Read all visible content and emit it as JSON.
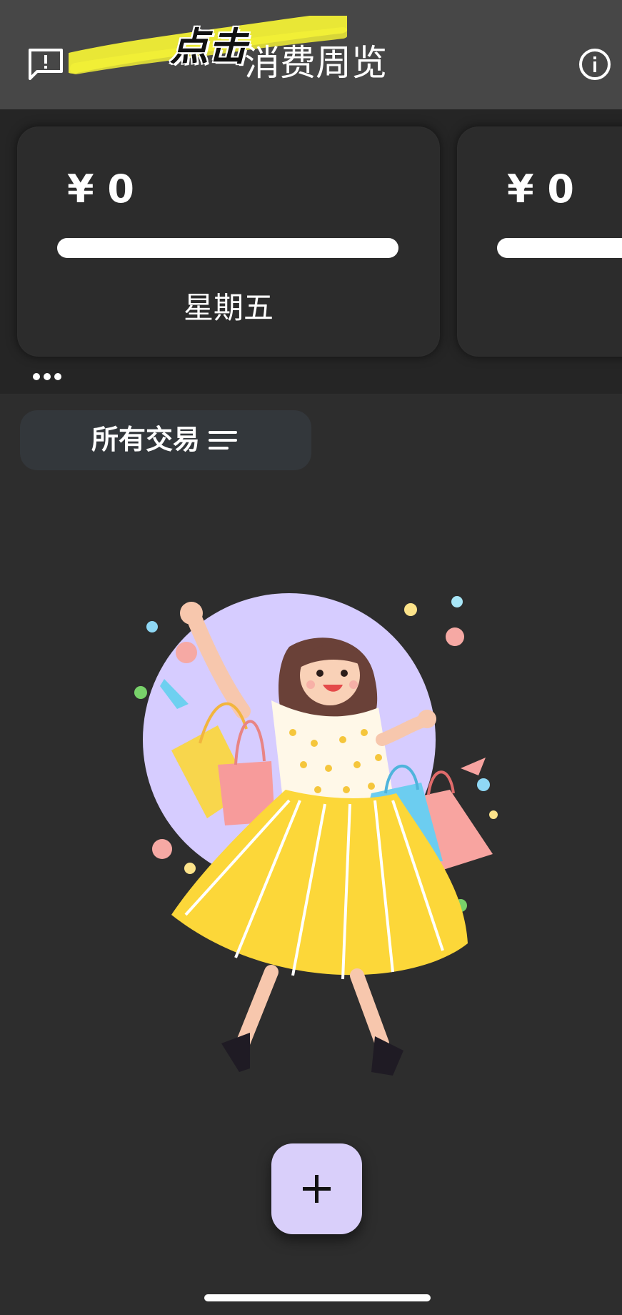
{
  "header": {
    "title": "消费周览",
    "annotation": "点击",
    "feedback_icon": "feedback-icon",
    "info_icon": "info-icon"
  },
  "summary": {
    "cards": [
      {
        "amount": "¥ 0",
        "weekday": "星期五",
        "progress": 1.0
      },
      {
        "amount": "¥ 0",
        "weekday": "",
        "progress": 1.0
      }
    ],
    "more_icon": "more-dots-icon"
  },
  "filter": {
    "label": "所有交易",
    "icon": "menu-lines-icon"
  },
  "empty_state": {
    "illustration": "shopping-woman-illustration"
  },
  "fab": {
    "icon": "plus-icon"
  },
  "colors": {
    "background": "#2d2d2d",
    "topbar": "#474747",
    "strip": "#252525",
    "card": "#2c2c2c",
    "filter_bg": "#33373b",
    "fab": "#d9cffa",
    "highlight": "#f2f036"
  }
}
